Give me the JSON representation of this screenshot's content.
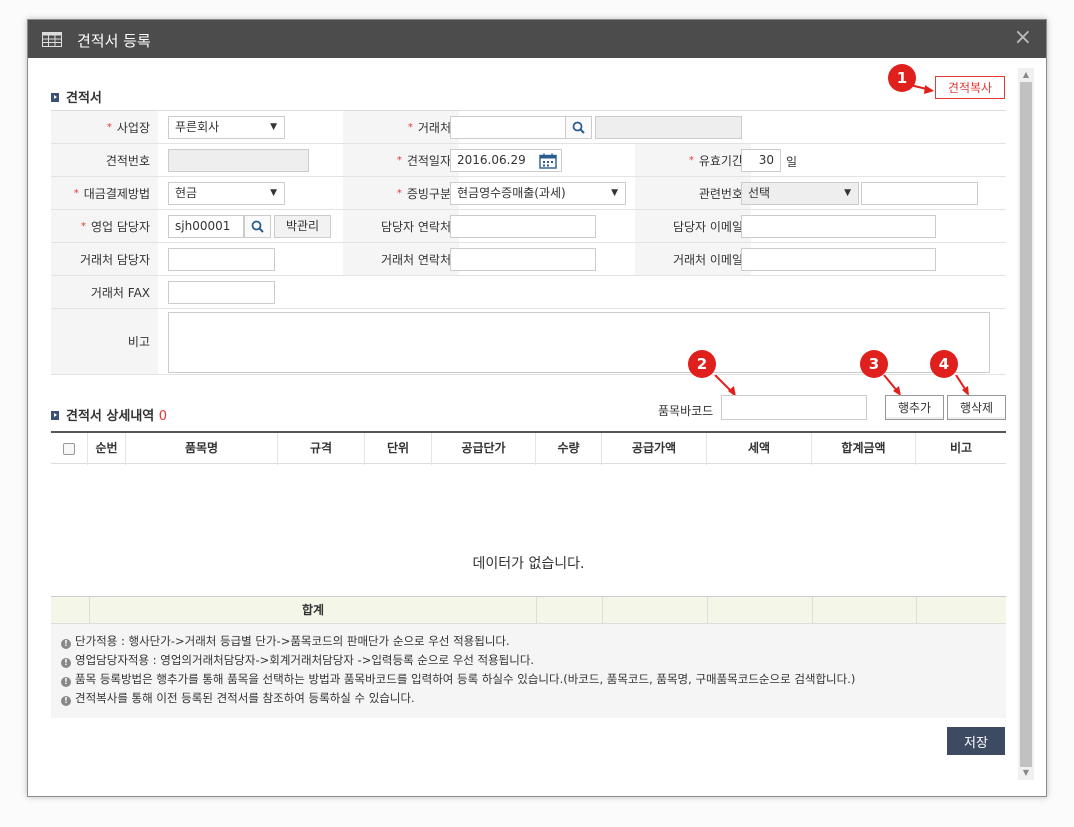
{
  "window": {
    "title": "견적서 등록",
    "close_icon": "×"
  },
  "header": {
    "section_title": "견적서",
    "copy_button": "견적복사"
  },
  "badges": [
    "1",
    "2",
    "3",
    "4"
  ],
  "form": {
    "business": {
      "label": "사업장",
      "value": "푸른회사"
    },
    "client": {
      "label": "거래처",
      "value": "",
      "name_value": ""
    },
    "quote_no": {
      "label": "견적번호",
      "value": ""
    },
    "quote_date": {
      "label": "견적일자",
      "value": "2016.06.29"
    },
    "valid_period": {
      "label": "유효기간",
      "value": "30",
      "unit": "일"
    },
    "payment": {
      "label": "대금결제방법",
      "value": "현금"
    },
    "proof": {
      "label": "증빙구분",
      "value": "현금영수증매출(과세)"
    },
    "related_no": {
      "label": "관련번호",
      "select_value": "선택",
      "value": ""
    },
    "sales_rep": {
      "label": "영업 담당자",
      "id_value": "sjh00001",
      "name_value": "박관리"
    },
    "rep_phone": {
      "label": "담당자 연락처",
      "value": ""
    },
    "rep_email": {
      "label": "담당자 이메일",
      "value": ""
    },
    "client_rep": {
      "label": "거래처 담당자",
      "value": ""
    },
    "client_phone": {
      "label": "거래처 연락처",
      "value": ""
    },
    "client_email": {
      "label": "거래처 이메일",
      "value": ""
    },
    "client_fax": {
      "label": "거래처 FAX",
      "value": ""
    },
    "memo": {
      "label": "비고",
      "value": ""
    }
  },
  "detail": {
    "title": "견적서 상세내역",
    "count": "0",
    "barcode_label": "품목바코드",
    "barcode_value": "",
    "add_row": "행추가",
    "delete_row": "행삭제",
    "columns": [
      "순번",
      "품목명",
      "규격",
      "단위",
      "공급단가",
      "수량",
      "공급가액",
      "세액",
      "합계금액",
      "비고"
    ],
    "empty_message": "데이터가 없습니다.",
    "total_label": "합계"
  },
  "notes": [
    "단가적용 : 행사단가->거래처 등급별 단가->품목코드의 판매단가 순으로 우선 적용됩니다.",
    "영업담당자적용 : 영업의거래처담당자->회계거래처담당자 ->입력등록 순으로 우선 적용됩니다.",
    "품목 등록방법은 행추가를 통해 품목을 선택하는 방법과 품목바코드를 입력하여 등록 하실수 있습니다.(바코드, 품목코드, 품목명, 구매품목코드순으로 검색합니다.)",
    "견적복사를 통해 이전 등록된 견적서를 참조하여 등록하실 수 있습니다."
  ],
  "footer": {
    "save_button": "저장"
  },
  "colors": {
    "titlebar": "#4c4c4c",
    "accent_red": "#e53935",
    "badge": "#e0201c",
    "save": "#3d4b62"
  }
}
